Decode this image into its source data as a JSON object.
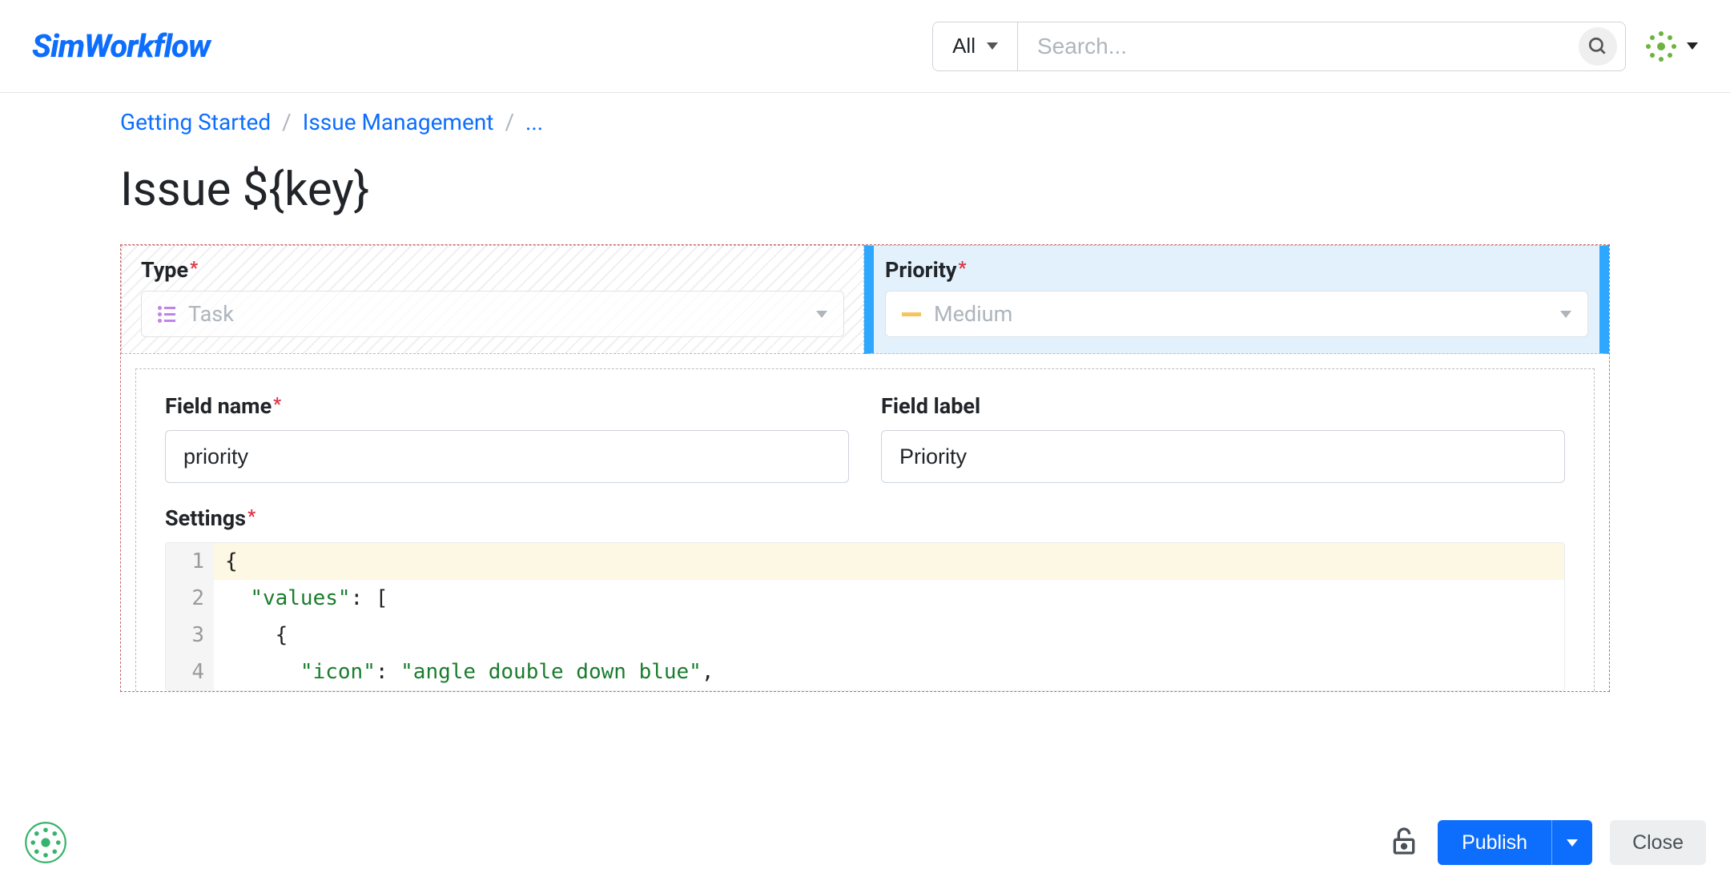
{
  "header": {
    "logo": "SimWorkflow",
    "filter": "All",
    "search_placeholder": "Search..."
  },
  "breadcrumb": {
    "items": [
      "Getting Started",
      "Issue Management"
    ],
    "more": "..."
  },
  "page_title": "Issue ${key}",
  "fields": {
    "type": {
      "label": "Type",
      "value": "Task"
    },
    "priority": {
      "label": "Priority",
      "value": "Medium"
    }
  },
  "editor": {
    "field_name": {
      "label": "Field name",
      "value": "priority"
    },
    "field_label": {
      "label": "Field label",
      "value": "Priority"
    },
    "settings_label": "Settings",
    "code": [
      {
        "n": "1",
        "indent": "",
        "t": [
          {
            "c": "punc",
            "v": "{"
          }
        ]
      },
      {
        "n": "2",
        "indent": "  ",
        "t": [
          {
            "c": "str",
            "v": "\"values\""
          },
          {
            "c": "punc",
            "v": ": ["
          }
        ]
      },
      {
        "n": "3",
        "indent": "    ",
        "t": [
          {
            "c": "punc",
            "v": "{"
          }
        ]
      },
      {
        "n": "4",
        "indent": "      ",
        "t": [
          {
            "c": "str",
            "v": "\"icon\""
          },
          {
            "c": "punc",
            "v": ": "
          },
          {
            "c": "str",
            "v": "\"angle double down blue\""
          },
          {
            "c": "punc",
            "v": ","
          }
        ]
      }
    ]
  },
  "footer": {
    "publish": "Publish",
    "close": "Close"
  }
}
